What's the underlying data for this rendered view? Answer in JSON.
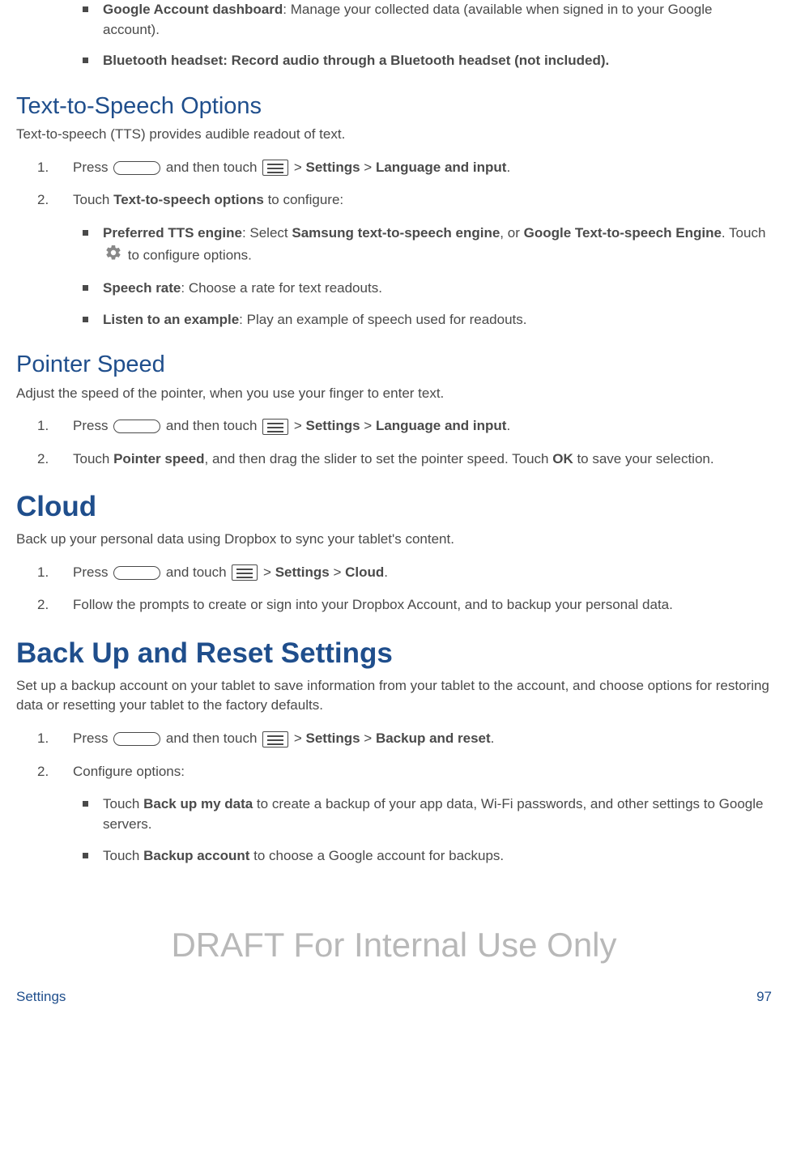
{
  "intro_bullets": [
    {
      "bold": "Google Account dashboard",
      "text": ": Manage your collected data (available when signed in to your Google account)."
    },
    {
      "bold": "Bluetooth headset: Record audio through a Bluetooth headset (not included).",
      "text": ""
    }
  ],
  "tts": {
    "heading": "Text-to-Speech Options",
    "intro": "Text-to-speech (TTS) provides audible readout of text.",
    "step1": {
      "press": "Press ",
      "mid": " and then touch ",
      "gt1": " > ",
      "settings": "Settings",
      "gt2": " > ",
      "lang": "Language and input",
      "dot": "."
    },
    "step2": {
      "pre": "Touch ",
      "bold": "Text-to-speech options",
      "post": " to configure:"
    },
    "sub": {
      "pref": {
        "b1": "Preferred TTS engine",
        "t1": ": Select ",
        "b2": "Samsung text-to-speech engine",
        "t2": ", or ",
        "b3": "Google Text-to-speech Engine",
        "t3": ". Touch ",
        "t4": " to configure options."
      },
      "rate": {
        "b": "Speech rate",
        "t": ": Choose a rate for text readouts."
      },
      "listen": {
        "b": "Listen to an example",
        "t": ": Play an example of speech used for readouts."
      }
    }
  },
  "pointer": {
    "heading": "Pointer Speed",
    "intro": "Adjust the speed of the pointer, when you use your finger to enter text.",
    "step1": {
      "press": "Press ",
      "mid": " and then touch ",
      "gt1": " > ",
      "settings": "Settings",
      "gt2": " > ",
      "lang": "Language and input",
      "dot": "."
    },
    "step2": {
      "pre": "Touch ",
      "b1": "Pointer speed",
      "mid": ", and then drag the slider to set the pointer speed. Touch ",
      "b2": "OK",
      "post": " to save your selection."
    }
  },
  "cloud": {
    "heading": "Cloud",
    "intro": "Back up your personal data using Dropbox to sync your tablet's content.",
    "step1": {
      "press": "Press ",
      "mid": " and touch ",
      "gt1": " > ",
      "settings": "Settings",
      "gt2": " > ",
      "cloud": "Cloud",
      "dot": "."
    },
    "step2": "Follow the prompts to create or sign into your Dropbox Account, and to backup your personal data."
  },
  "backup": {
    "heading": "Back Up and Reset Settings",
    "intro": "Set up a backup account on your tablet to save information from your tablet to the account, and choose options for restoring data or resetting your tablet to the factory defaults.",
    "step1": {
      "press": "Press ",
      "mid": " and then touch ",
      "gt1": " > ",
      "settings": "Settings",
      "gt2": " > ",
      "br": "Backup and reset",
      "dot": "."
    },
    "step2": "Configure options:",
    "sub": {
      "data": {
        "pre": "Touch ",
        "b": "Back up my data",
        "post": " to create a backup of your app data, Wi-Fi passwords, and other settings to Google servers."
      },
      "acct": {
        "pre": "Touch ",
        "b": "Backup account",
        "post": " to choose a Google account for backups."
      }
    }
  },
  "watermark": "DRAFT For Internal Use Only",
  "footer": {
    "left": "Settings",
    "right": "97"
  },
  "numbers": {
    "n1": "1.",
    "n2": "2."
  }
}
